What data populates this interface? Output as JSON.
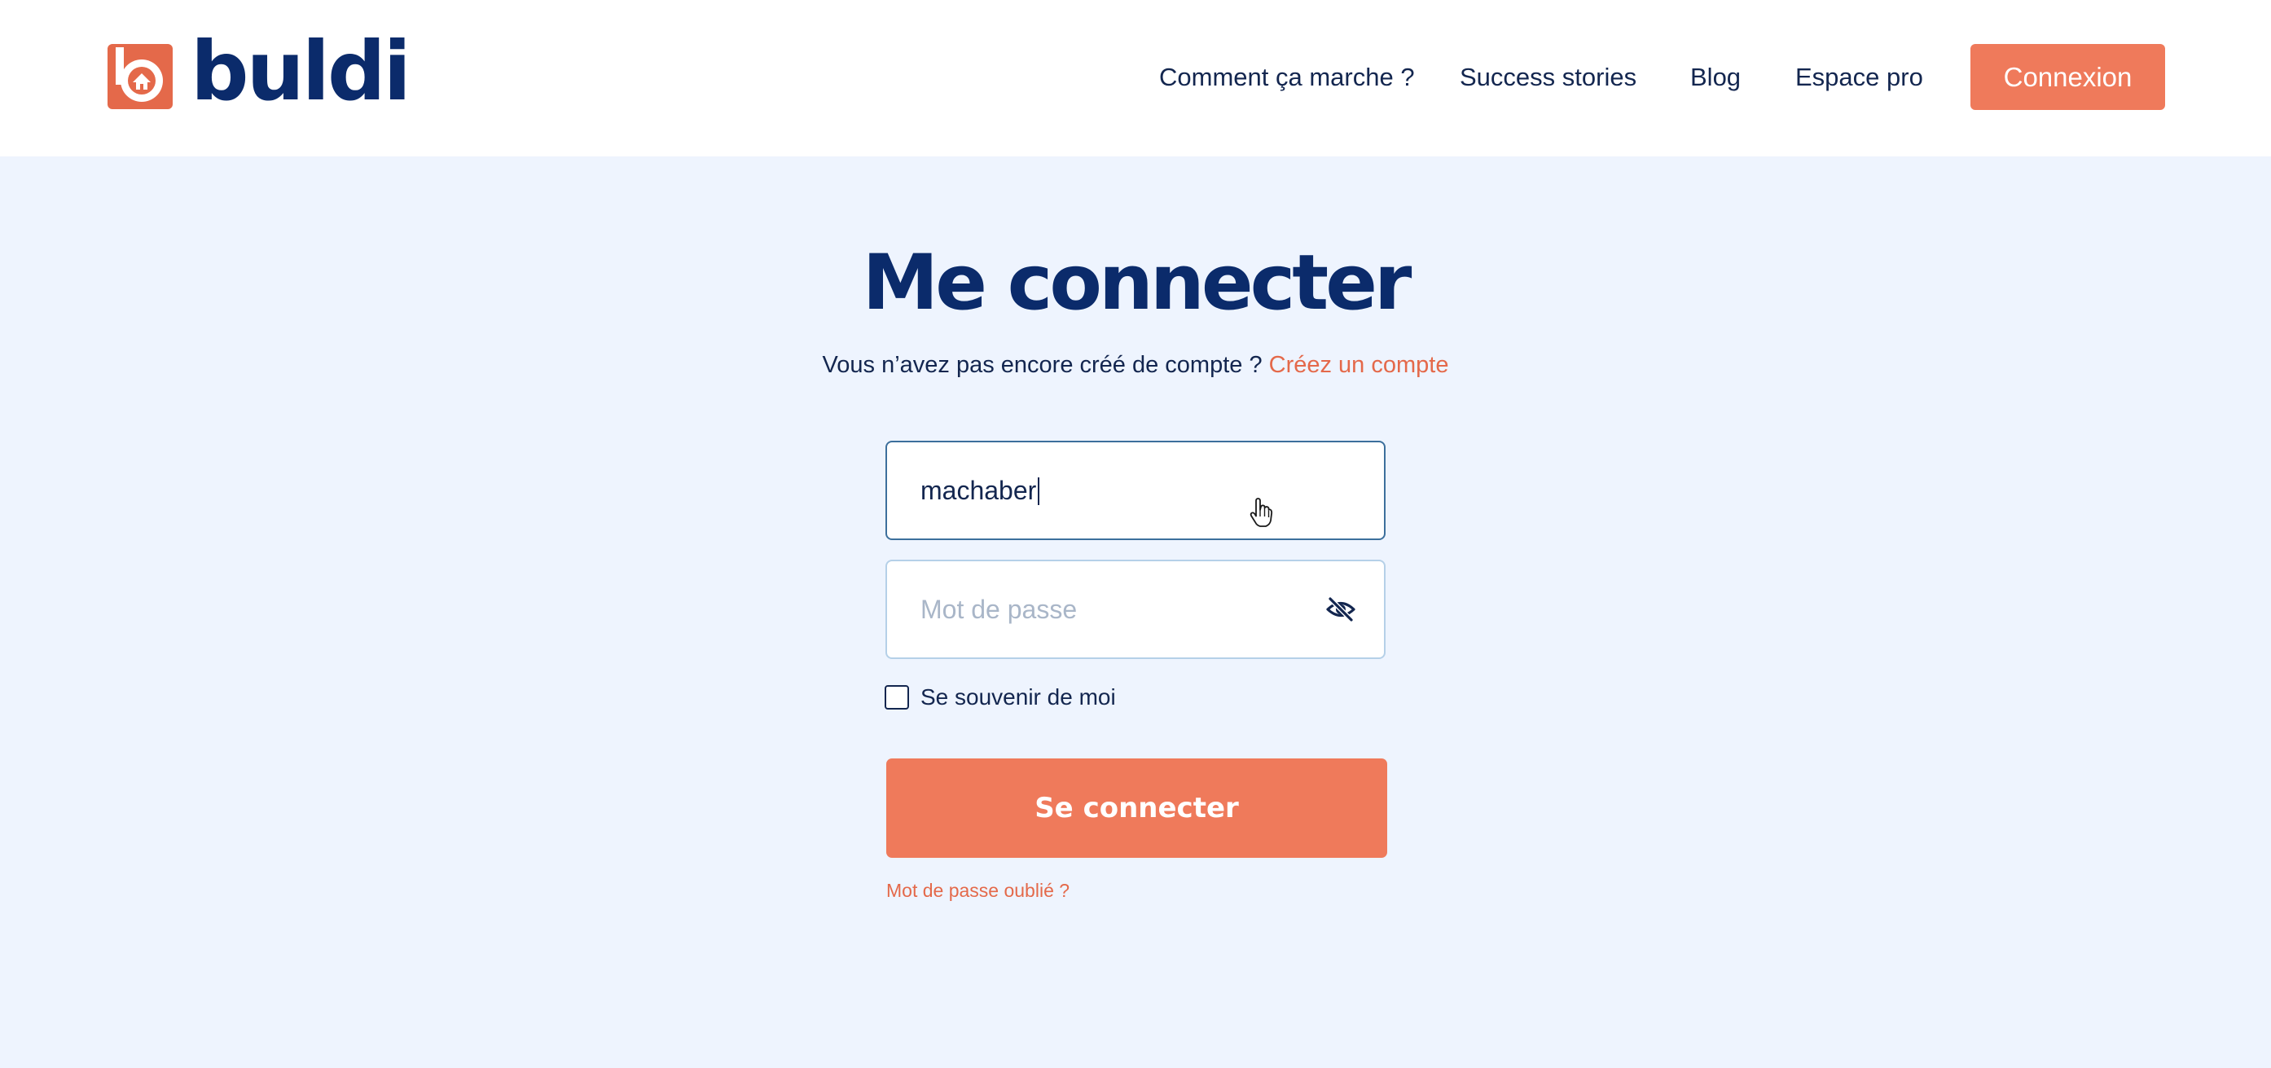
{
  "header": {
    "logo_text": "buldi",
    "nav": {
      "how_it_works": "Comment ça marche ?",
      "success_stories": "Success stories",
      "blog": "Blog",
      "pro_space": "Espace pro",
      "login": "Connexion"
    }
  },
  "login": {
    "title": "Me connecter",
    "subtitle_text": "Vous n’avez pas encore créé de compte ?",
    "create_account_link": "Créez un compte",
    "username": {
      "value": "machaber"
    },
    "password": {
      "placeholder": "Mot de passe",
      "visibility_icon": "eye-slash-icon"
    },
    "remember_me": {
      "label": "Se souvenir de moi",
      "checked": false
    },
    "submit_label": "Se connecter",
    "forgot_password": "Mot de passe oublié ?"
  },
  "colors": {
    "brand_navy": "#0b2b6b",
    "accent_orange": "#ef7a5b",
    "link_orange": "#e4694a",
    "page_background": "#eef4fe",
    "focused_border": "#3c6f9c",
    "input_border": "#b5d0e8"
  }
}
